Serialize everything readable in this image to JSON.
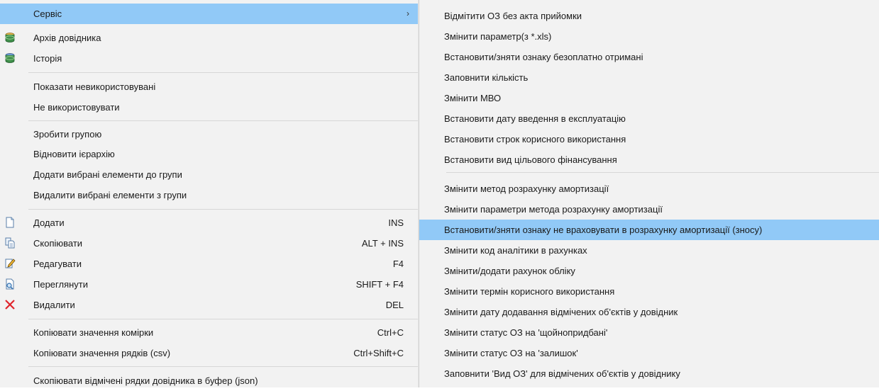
{
  "main_menu": {
    "service": {
      "label": "Сервіс"
    },
    "archive": {
      "label": "Архів довідника"
    },
    "history": {
      "label": "Історія"
    },
    "show_unused": {
      "label": "Показати невикористовувані"
    },
    "dont_use": {
      "label": "Не використовувати"
    },
    "make_group": {
      "label": "Зробити групою"
    },
    "restore_hierarchy": {
      "label": "Відновити ієрархію"
    },
    "add_to_group": {
      "label": "Додати вибрані елементи до групи"
    },
    "remove_from_group": {
      "label": "Видалити вибрані елементи з групи"
    },
    "add": {
      "label": "Додати",
      "shortcut": "INS"
    },
    "copy": {
      "label": "Скопіювати",
      "shortcut": "ALT + INS"
    },
    "edit": {
      "label": "Редагувати",
      "shortcut": "F4"
    },
    "view": {
      "label": "Переглянути",
      "shortcut": "SHIFT + F4"
    },
    "delete": {
      "label": "Видалити",
      "shortcut": "DEL"
    },
    "copy_cell": {
      "label": "Копіювати значення комірки",
      "shortcut": "Ctrl+C"
    },
    "copy_rows": {
      "label": "Копіювати значення рядків (csv)",
      "shortcut": "Ctrl+Shift+C"
    },
    "copy_json": {
      "label": "Скопіювати відмічені рядки довідника в буфер (json)"
    }
  },
  "sub_menu": {
    "items": [
      "Відмітити ОЗ без акта прийомки",
      "Змінити параметр(з *.xls)",
      "Встановити/зняти ознаку безоплатно отримані",
      "Заповнити кількість",
      "Змінити МВО",
      "Встановити дату введення в експлуатацію",
      "Встановити строк корисного використання",
      "Встановити вид цільового фінансування",
      "Змінити метод розрахунку амортизації",
      "Змінити параметри метода розрахунку амортизації",
      "Встановити/зняти ознаку не враховувати в розрахунку амортизації (зносу)",
      "Змінити код аналітики в рахунках",
      "Змінити/додати рахунок обліку",
      "Змінити термін корисного використання",
      "Змінити дату додавання відмічених об'єктів у довідник",
      "Змінити статус ОЗ на 'щойнопридбані'",
      "Змінити статус ОЗ на 'залишок'",
      "Заповнити 'Вид ОЗ' для відмічених об'єктів у довіднику"
    ]
  },
  "colors": {
    "menu_bg": "#f2f2f2",
    "highlight": "#91c9f7",
    "delete_icon": "#e0242b"
  }
}
